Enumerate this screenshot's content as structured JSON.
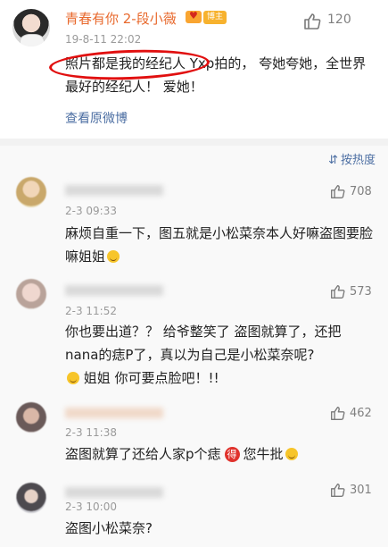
{
  "post": {
    "username": "青春有你 2-段小薇",
    "badge": "博主",
    "likes": "120",
    "time": "19-8-11 22:02",
    "text": "照片都是我的经纪人 Yxp拍的， 夸她夸她，全世界最好的经纪人！ 爱她！",
    "view_original": "查看原微博"
  },
  "sort_label": "按热度",
  "comments": [
    {
      "time": "2-3 09:33",
      "likes": "708",
      "text": "麻烦自重一下，图五就是小松菜奈本人好嘛盗图要脸嘛姐姐",
      "text_after": ""
    },
    {
      "time": "2-3 11:52",
      "likes": "573",
      "text": "你也要出道？？ 给爷整笑了 盗图就算了，还把nana的痣P了，真以为自己是小松菜奈呢?",
      "text_after": "姐姐 你可要点脸吧！!!"
    },
    {
      "time": "2-3 11:38",
      "likes": "462",
      "text": "盗图就算了还给人家p个痣",
      "text_after": "您牛批"
    },
    {
      "time": "2-3 10:00",
      "likes": "301",
      "text": "盗图小松菜奈?",
      "text_after": ""
    }
  ],
  "emoji_de": "得"
}
